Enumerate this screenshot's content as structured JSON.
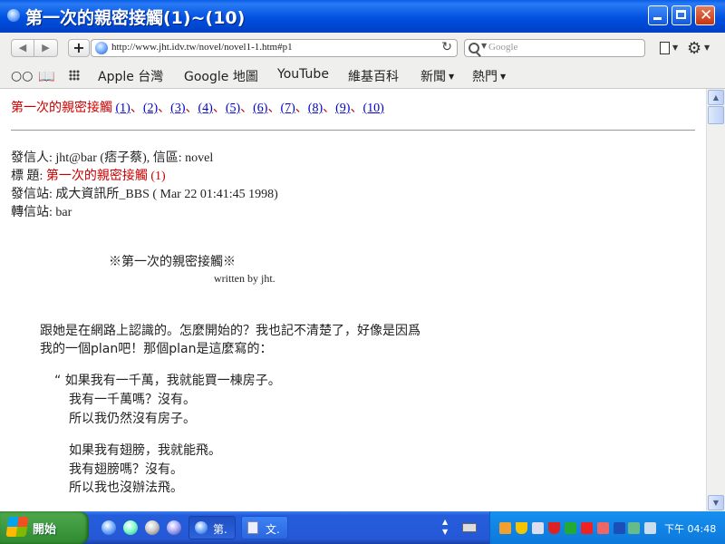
{
  "window": {
    "title": "第一次的親密接觸(1)~(10)"
  },
  "toolbar": {
    "url": "http://www.jht.idv.tw/novel/novel1-1.htm#p1",
    "search_placeholder": "Google"
  },
  "bookmarks": [
    {
      "label": "Apple 台灣",
      "has_menu": false
    },
    {
      "label": "Google 地圖",
      "has_menu": false
    },
    {
      "label": "YouTube",
      "has_menu": false
    },
    {
      "label": "維基百科",
      "has_menu": false
    },
    {
      "label": "新聞",
      "has_menu": true
    },
    {
      "label": "熱門",
      "has_menu": true
    }
  ],
  "page": {
    "title_red": "第一次的親密接觸",
    "chapter_links": [
      "(1)",
      "(2)",
      "(3)",
      "(4)",
      "(5)",
      "(6)",
      "(7)",
      "(8)",
      "(9)",
      "(10)"
    ],
    "separator": "、",
    "header": {
      "from": "發信人: jht@bar (痞子蔡), 信區: novel",
      "subject_label": "標  題: ",
      "subject_value": "第一次的親密接觸 (1)",
      "site": "發信站: 成大資訊所_BBS ( Mar 22 01:41:45 1998)",
      "relay": "轉信站: bar"
    },
    "story_title": "※第一次的親密接觸※",
    "story_byline": "written by jht.",
    "paragraphs": [
      "跟她是在網路上認識的。怎麼開始的？我也記不清楚了，好像是因爲",
      "我的一個plan吧！那個plan是這麼寫的：",
      "“ 如果我有一千萬，我就能買一棟房子。",
      "我有一千萬嗎？沒有。",
      "所以我仍然沒有房子。",
      "如果我有翅膀，我就能飛。",
      "我有翅膀嗎？沒有。",
      "所以我也沒辦法飛。"
    ]
  },
  "taskbar": {
    "start_label": "開始",
    "tasks": [
      {
        "label": "第."
      },
      {
        "label": "文."
      }
    ],
    "clock": "下午 04:48"
  }
}
